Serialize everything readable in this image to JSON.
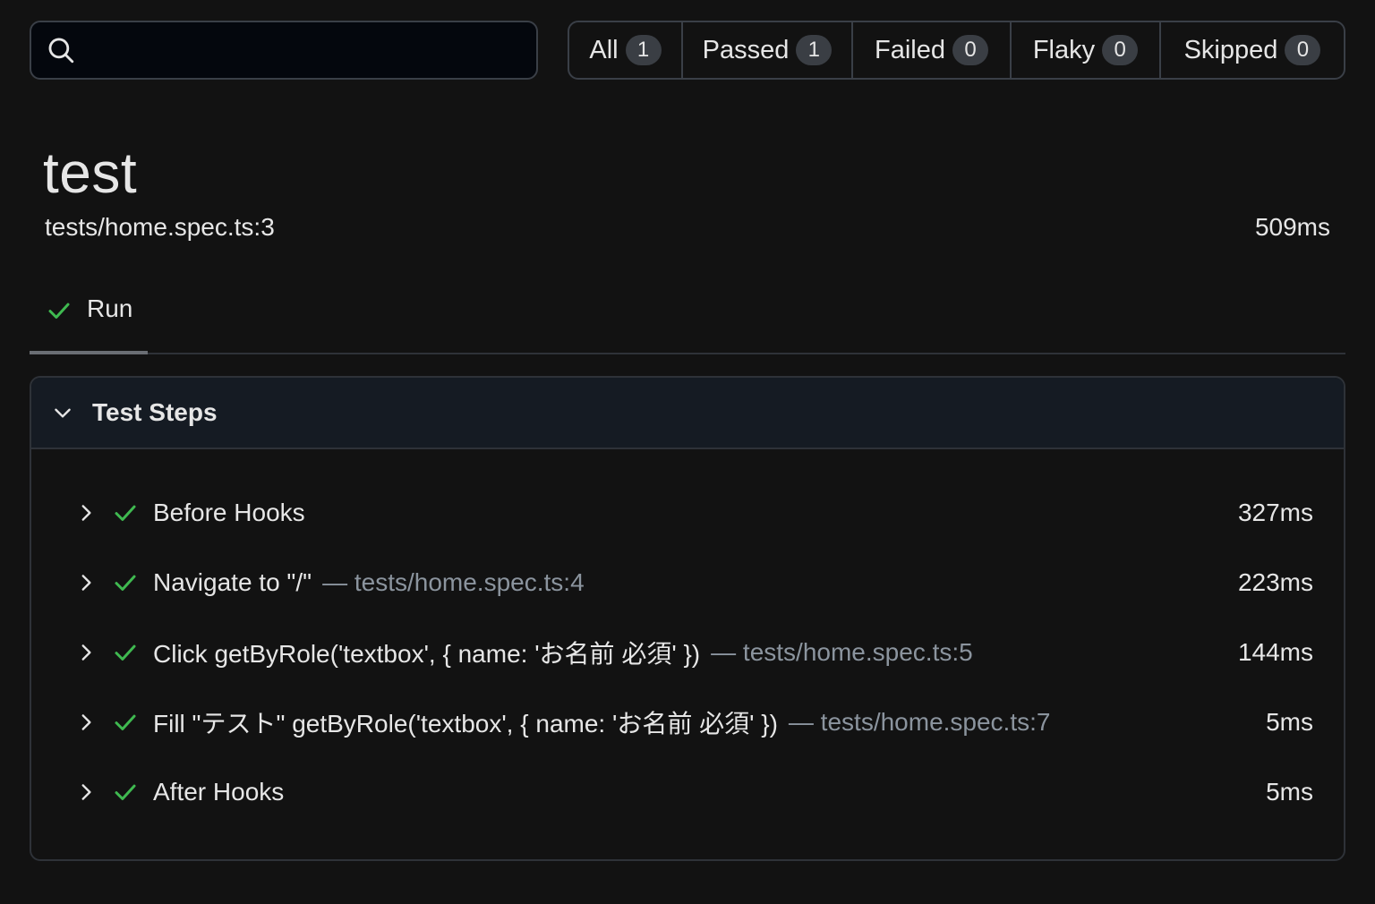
{
  "search": {
    "placeholder": "",
    "value": ""
  },
  "filters": [
    {
      "label": "All",
      "count": "1"
    },
    {
      "label": "Passed",
      "count": "1"
    },
    {
      "label": "Failed",
      "count": "0"
    },
    {
      "label": "Flaky",
      "count": "0"
    },
    {
      "label": "Skipped",
      "count": "0"
    }
  ],
  "test": {
    "title": "test",
    "location": "tests/home.spec.ts:3",
    "duration": "509ms"
  },
  "tabs": [
    {
      "label": "Run",
      "status": "passed"
    }
  ],
  "panel": {
    "title": "Test Steps",
    "steps": [
      {
        "label": "Before Hooks",
        "location": "",
        "duration": "327ms"
      },
      {
        "label": "Navigate to \"/\"",
        "location": "— tests/home.spec.ts:4",
        "duration": "223ms"
      },
      {
        "label": "Click getByRole('textbox', { name: 'お名前 必須' })",
        "location": "— tests/home.spec.ts:5",
        "duration": "144ms"
      },
      {
        "label": "Fill \"テスト\" getByRole('textbox', { name: 'お名前 必須' })",
        "location": "— tests/home.spec.ts:7",
        "duration": "5ms"
      },
      {
        "label": "After Hooks",
        "location": "",
        "duration": "5ms"
      }
    ]
  },
  "colors": {
    "passed": "#3fb950",
    "muted": "#8b949e",
    "accent_bg": "#151b23"
  },
  "icons": {
    "search": "search-icon",
    "check": "check-icon",
    "chevron_right": "chevron-right-icon",
    "chevron_down": "chevron-down-icon"
  }
}
